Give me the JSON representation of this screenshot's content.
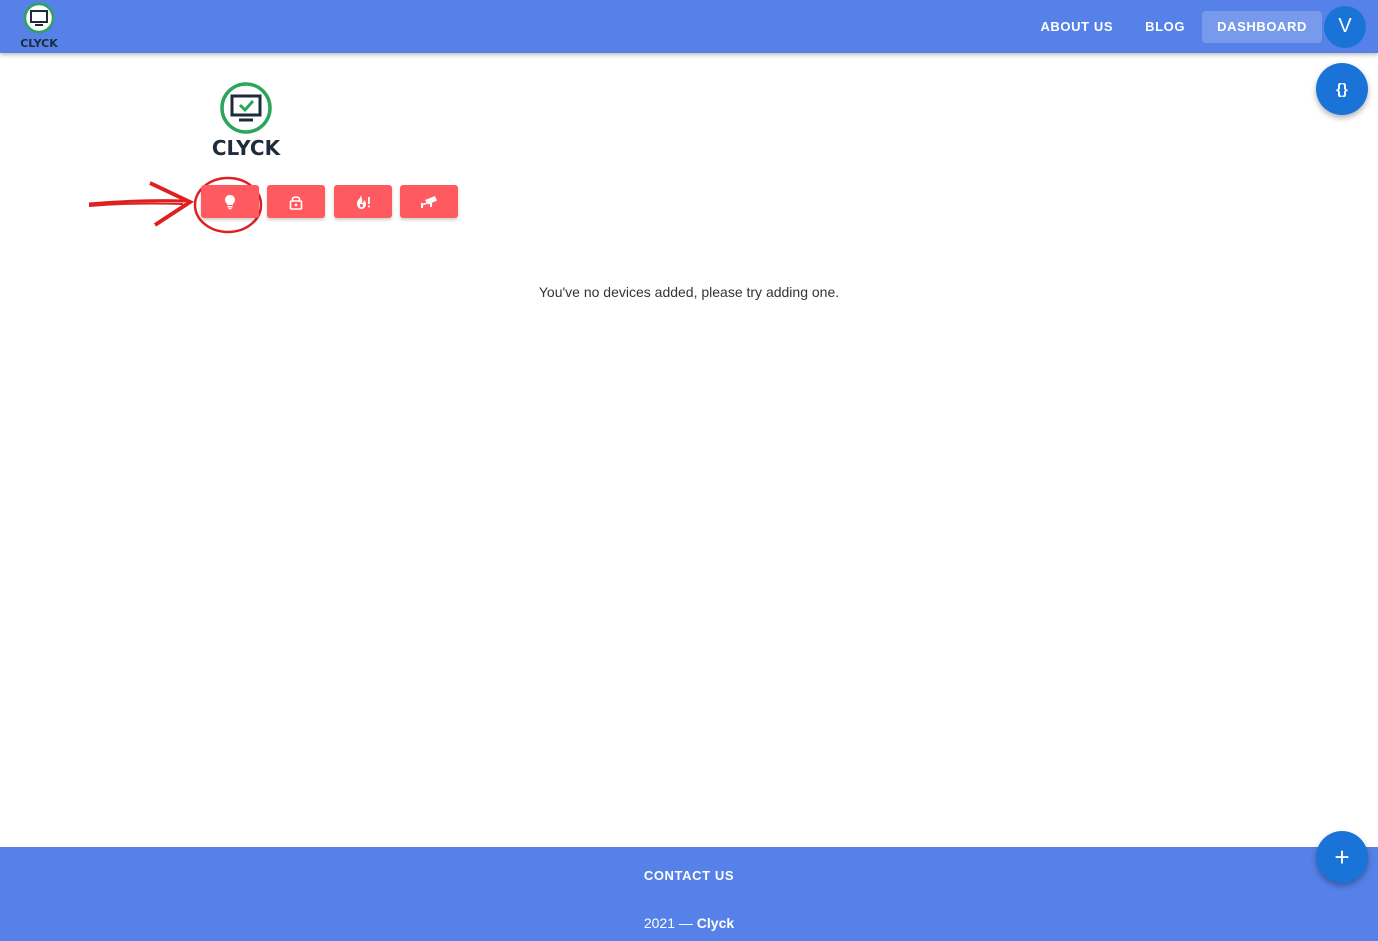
{
  "header": {
    "brand_text": "CLYCK",
    "nav": [
      "ABOUT US",
      "BLOG",
      "DASHBOARD"
    ],
    "active_nav": "DASHBOARD",
    "avatar_initial": "V"
  },
  "logo": {
    "text": "CLYCK"
  },
  "category_buttons": [
    {
      "icon": "lightbulb-icon"
    },
    {
      "icon": "lock-icon"
    },
    {
      "icon": "fire-alarm-icon"
    },
    {
      "icon": "security-camera-icon"
    }
  ],
  "main": {
    "empty_message": "You've no devices added, please try adding one."
  },
  "fab": {
    "code_label": "{}",
    "add_label": "+"
  },
  "footer": {
    "contact_label": "CONTACT US",
    "copyright_prefix": "2021 — ",
    "brand": "Clyck"
  },
  "colors": {
    "appbar": "#5581e8",
    "accent": "#1a74d8",
    "category_button": "#ff5a5f",
    "annotation": "#e02020",
    "logo_ring": "#2aa55a"
  }
}
